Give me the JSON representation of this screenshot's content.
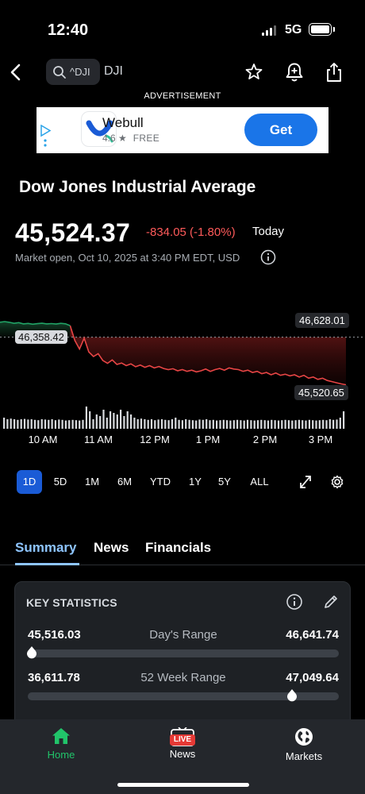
{
  "status_bar": {
    "time": "12:40",
    "network": "5G"
  },
  "nav": {
    "search_symbol": "^DJI",
    "ticker": "DJI"
  },
  "ad": {
    "label": "ADVERTISEMENT",
    "app_name": "Webull",
    "rating": "4.6",
    "price_label": "FREE",
    "cta": "Get"
  },
  "quote": {
    "title": "Dow Jones Industrial Average",
    "price": "45,524.37",
    "change": "-834.05 (-1.80%)",
    "period": "Today",
    "status": "Market open, Oct 10, 2025 at 3:40 PM EDT, USD"
  },
  "chart_data": {
    "type": "line",
    "x_ticks": [
      "10 AM",
      "11 AM",
      "12 PM",
      "1 PM",
      "2 PM",
      "3 PM"
    ],
    "previous_close": "46,358.42",
    "high_label": "46,628.01",
    "last_label": "45,520.65",
    "ylim": [
      45450,
      46700
    ],
    "series": [
      {
        "values": [
          46620,
          46630,
          46618,
          46600,
          46612,
          46590,
          46598,
          46585,
          46594,
          46602,
          46590,
          46596,
          46588,
          46600,
          46592,
          46560,
          46300,
          46150,
          46340,
          46100,
          46020,
          46070,
          45950,
          45900,
          45960,
          45880,
          45905,
          45860,
          45890,
          45840,
          45870,
          45830,
          45860,
          45820,
          45845,
          45810,
          45790,
          45805,
          45770,
          45790,
          45760,
          45780,
          45750,
          45770,
          45800,
          45760,
          45790,
          45810,
          45780,
          45820,
          45800,
          45790,
          45760,
          45780,
          45740,
          45760,
          45720,
          45740,
          45700,
          45730,
          45690,
          45710,
          45680,
          45700,
          45660,
          45690,
          45640,
          45660,
          45620,
          45640,
          45600,
          45580,
          45560,
          45540,
          45525
        ]
      }
    ],
    "volume": [
      0.35,
      0.3,
      0.32,
      0.3,
      0.28,
      0.3,
      0.31,
      0.29,
      0.3,
      0.28,
      0.27,
      0.3,
      0.29,
      0.28,
      0.3,
      0.27,
      0.29,
      0.28,
      0.26,
      0.27,
      0.28,
      0.27,
      0.26,
      0.28,
      0.7,
      0.55,
      0.3,
      0.45,
      0.4,
      0.6,
      0.35,
      0.55,
      0.5,
      0.45,
      0.6,
      0.4,
      0.55,
      0.45,
      0.35,
      0.3,
      0.32,
      0.3,
      0.28,
      0.3,
      0.27,
      0.29,
      0.3,
      0.28,
      0.27,
      0.3,
      0.35,
      0.28,
      0.27,
      0.3,
      0.28,
      0.27,
      0.26,
      0.29,
      0.28,
      0.3,
      0.27,
      0.28,
      0.26,
      0.27,
      0.28,
      0.27,
      0.26,
      0.27,
      0.28,
      0.27,
      0.26,
      0.28,
      0.27,
      0.26,
      0.27,
      0.28,
      0.27,
      0.26,
      0.28,
      0.27,
      0.26,
      0.27,
      0.28,
      0.27,
      0.26,
      0.27,
      0.28,
      0.27,
      0.26,
      0.28,
      0.27,
      0.26,
      0.27,
      0.28,
      0.27,
      0.3,
      0.28,
      0.29,
      0.35,
      0.55
    ]
  },
  "ranges": [
    "1D",
    "5D",
    "1M",
    "6M",
    "YTD",
    "1Y",
    "5Y",
    "ALL"
  ],
  "active_range": "1D",
  "tabs": [
    "Summary",
    "News",
    "Financials"
  ],
  "key_stats": {
    "title": "KEY STATISTICS",
    "days_range": {
      "low": "45,516.03",
      "label": "Day's Range",
      "high": "46,641.74",
      "position": 0.0
    },
    "week52_range": {
      "low": "36,611.78",
      "label": "52 Week Range",
      "high": "47,049.64",
      "position": 0.85
    }
  },
  "bottom_nav": {
    "home": "Home",
    "news": "News",
    "live_badge": "LIVE",
    "markets": "Markets"
  },
  "colors": {
    "up": "#21a366",
    "down": "#e84545",
    "accent": "#1a75e8",
    "active_tab": "#8ec5ff"
  }
}
